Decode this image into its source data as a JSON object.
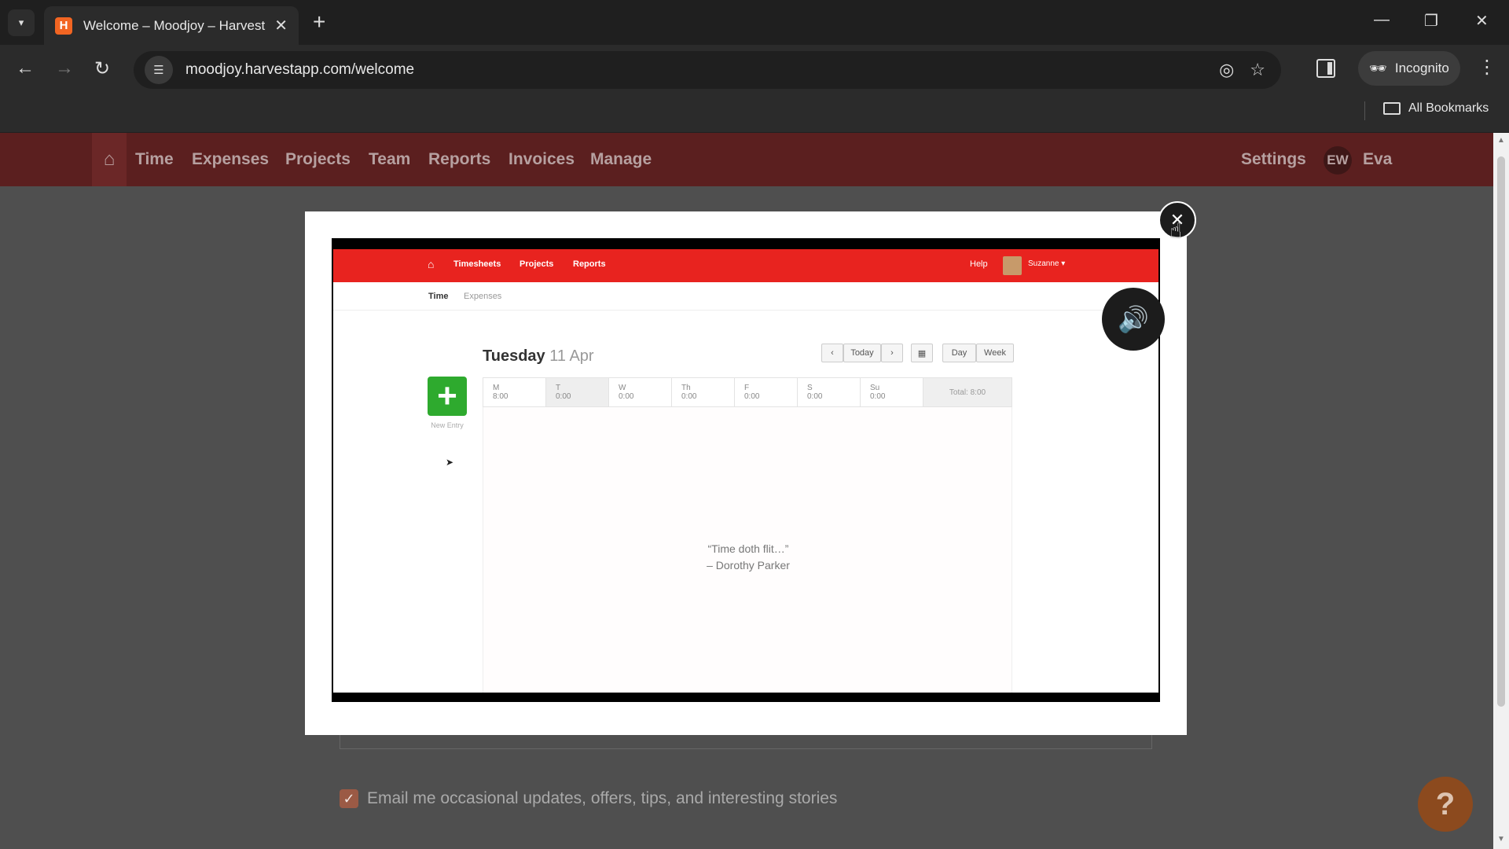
{
  "browser": {
    "tab_title": "Welcome – Moodjoy – Harvest",
    "tab_favicon_letter": "H",
    "url": "moodjoy.harvestapp.com/welcome",
    "incognito_label": "Incognito",
    "all_bookmarks_label": "All Bookmarks"
  },
  "app_nav": {
    "items": [
      "Time",
      "Expenses",
      "Projects",
      "Team",
      "Reports",
      "Invoices",
      "Manage"
    ],
    "settings_label": "Settings",
    "avatar_initials": "EW",
    "user_name": "Eva"
  },
  "modal": {
    "video": {
      "nav_items": [
        "Timesheets",
        "Projects",
        "Reports"
      ],
      "help_label": "Help",
      "user_label": "Suzanne ▾",
      "sub_tabs": [
        "Time",
        "Expenses"
      ],
      "day": "Tuesday",
      "date": "11 Apr",
      "today_label": "Today",
      "view_day_label": "Day",
      "view_week_label": "Week",
      "new_entry_label": "New Entry",
      "week_days": [
        {
          "day": "M",
          "hours": "8:00"
        },
        {
          "day": "T",
          "hours": "0:00"
        },
        {
          "day": "W",
          "hours": "0:00"
        },
        {
          "day": "Th",
          "hours": "0:00"
        },
        {
          "day": "F",
          "hours": "0:00"
        },
        {
          "day": "S",
          "hours": "0:00"
        },
        {
          "day": "Su",
          "hours": "0:00"
        }
      ],
      "total_label": "Total: 8:00",
      "quote_line1": "“Time doth flit…”",
      "quote_line2": "– Dorothy Parker"
    }
  },
  "page": {
    "email_opt_in_label": "Email me occasional updates, offers, tips, and interesting stories",
    "email_opt_in_checked": true,
    "help_glyph": "?"
  },
  "colors": {
    "harvest_nav_dim": "#5b1f1f",
    "video_nav_red": "#e8231f",
    "new_entry_green": "#2eaa2e"
  }
}
